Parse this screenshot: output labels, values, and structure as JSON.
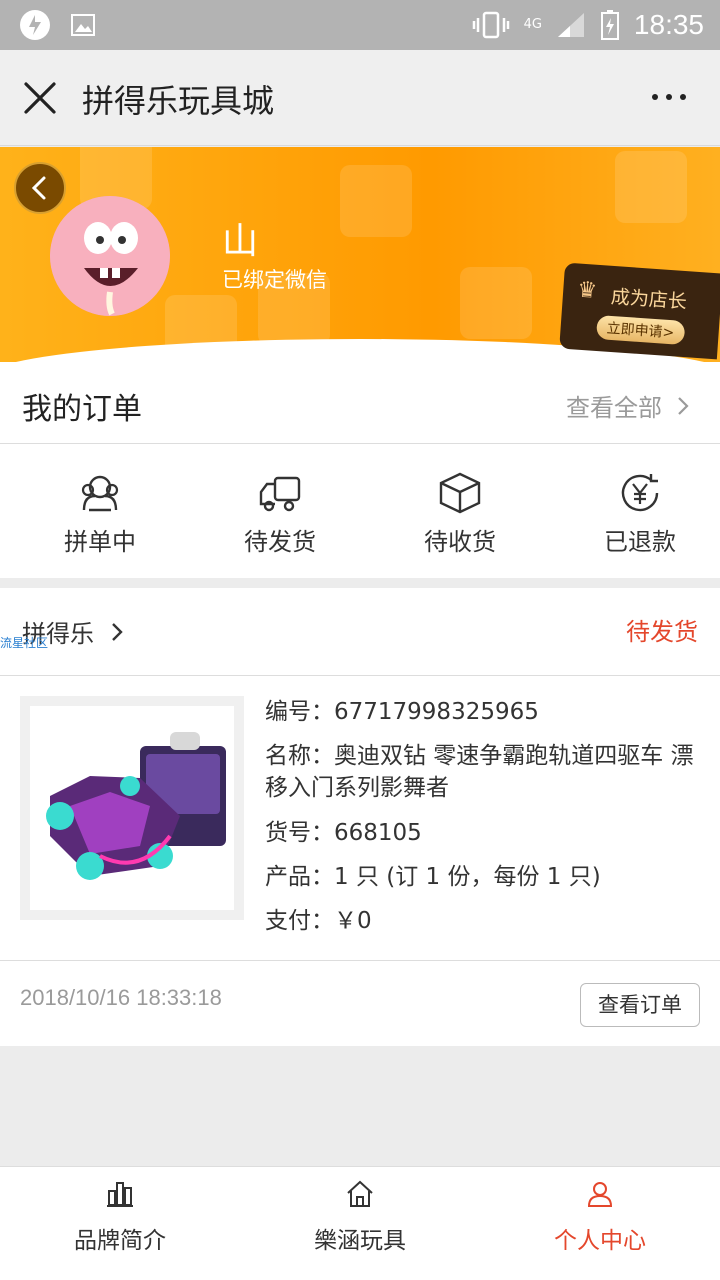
{
  "status_bar": {
    "time": "18:35",
    "network": "4G"
  },
  "titlebar": {
    "title": "拼得乐玩具城"
  },
  "profile": {
    "name": "山",
    "subtitle": "已绑定微信",
    "shop_badge": {
      "title": "成为店长",
      "action": "立即申请>"
    }
  },
  "orders": {
    "heading": "我的订单",
    "view_all": "查看全部",
    "statuses": [
      {
        "label": "拼单中",
        "icon": "group-icon"
      },
      {
        "label": "待发货",
        "icon": "truck-icon"
      },
      {
        "label": "待收货",
        "icon": "box-icon"
      },
      {
        "label": "已退款",
        "icon": "refund-icon"
      }
    ]
  },
  "order_card": {
    "shop_name": "拼得乐",
    "watermark": "流星社区",
    "status": "待发货",
    "number": "编号：67717998325965",
    "name": "名称：奥迪双钻 零速争霸跑轨道四驱车 漂移入门系列影舞者",
    "item_no": "货号：668105",
    "quantity": "产品：1 只 (订 1 份，每份 1 只)",
    "payment": "支付：￥0",
    "time": "2018/10/16 18:33:18",
    "view_order": "查看订单"
  },
  "bottom_nav": [
    {
      "label": "品牌简介",
      "icon": "bar-chart-icon",
      "active": false
    },
    {
      "label": "樂涵玩具",
      "icon": "home-icon",
      "active": false
    },
    {
      "label": "个人中心",
      "icon": "user-icon",
      "active": true
    }
  ],
  "colors": {
    "accent": "#e4472c",
    "banner": "#ff9a00"
  }
}
